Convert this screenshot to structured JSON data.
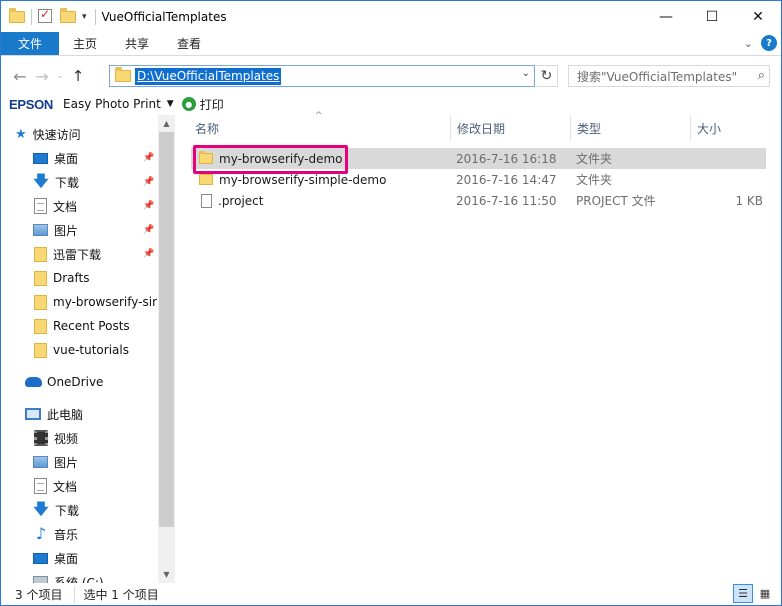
{
  "window": {
    "title": "VueOfficialTemplates",
    "controls": {
      "minimize": "—",
      "maximize": "☐",
      "close": "✕"
    }
  },
  "ribbon": {
    "tabs": [
      {
        "label": "文件",
        "active": true
      },
      {
        "label": "主页"
      },
      {
        "label": "共享"
      },
      {
        "label": "查看"
      }
    ],
    "collapse_icon": "chevron-down-icon",
    "help_label": "?"
  },
  "address": {
    "path": "D:\\VueOfficialTemplates",
    "search_placeholder": "搜索\"VueOfficialTemplates\""
  },
  "epson_bar": {
    "brand": "EPSON",
    "app": "Easy Photo Print",
    "print_label": "打印"
  },
  "nav": {
    "quick_access": "快速访问",
    "quick_items": [
      {
        "label": "桌面",
        "icon": "desktop-icon",
        "pinned": true
      },
      {
        "label": "下载",
        "icon": "download-icon",
        "pinned": true
      },
      {
        "label": "文档",
        "icon": "documents-icon",
        "pinned": true
      },
      {
        "label": "图片",
        "icon": "pictures-icon",
        "pinned": true
      },
      {
        "label": "迅雷下载",
        "icon": "folder-icon",
        "pinned": true
      },
      {
        "label": "Drafts",
        "icon": "folder-icon"
      },
      {
        "label": "my-browserify-sir",
        "icon": "folder-icon"
      },
      {
        "label": "Recent Posts",
        "icon": "folder-icon"
      },
      {
        "label": "vue-tutorials",
        "icon": "folder-icon"
      }
    ],
    "onedrive": "OneDrive",
    "this_pc": "此电脑",
    "pc_items": [
      {
        "label": "视频",
        "icon": "videos-icon"
      },
      {
        "label": "图片",
        "icon": "pictures-icon"
      },
      {
        "label": "文档",
        "icon": "documents-icon"
      },
      {
        "label": "下载",
        "icon": "download-icon"
      },
      {
        "label": "音乐",
        "icon": "music-icon"
      },
      {
        "label": "桌面",
        "icon": "desktop-icon"
      },
      {
        "label": "系统 (C:)",
        "icon": "drive-icon"
      }
    ]
  },
  "files": {
    "columns": [
      "名称",
      "修改日期",
      "类型",
      "大小"
    ],
    "rows": [
      {
        "name": "my-browserify-demo",
        "modified": "2016-7-16 16:18",
        "type": "文件夹",
        "size": "",
        "kind": "folder",
        "selected": true
      },
      {
        "name": "my-browserify-simple-demo",
        "modified": "2016-7-16 14:47",
        "type": "文件夹",
        "size": "",
        "kind": "folder"
      },
      {
        "name": ".project",
        "modified": "2016-7-16 11:50",
        "type": "PROJECT 文件",
        "size": "1 KB",
        "kind": "file"
      }
    ]
  },
  "status": {
    "item_count": "3 个项目",
    "selected": "选中 1 个项目"
  },
  "colors": {
    "accent": "#1979ca",
    "selection": "#d9d9d9",
    "highlight_box": "#e6007e"
  }
}
